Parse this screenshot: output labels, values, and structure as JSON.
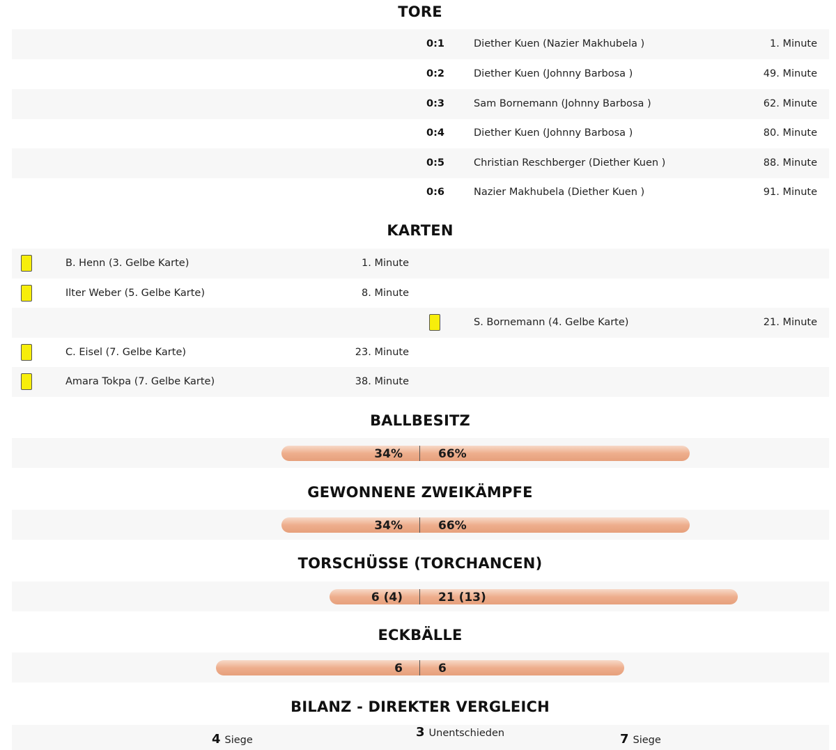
{
  "sections": {
    "tore": "TORE",
    "karten": "KARTEN",
    "ballbesitz": "BALLBESITZ",
    "zweikaempfe": "GEWONNENE ZWEIKÄMPFE",
    "torschuesse": "TORSCHÜSSE (TORCHANCEN)",
    "eckbaelle": "ECKBÄLLE",
    "bilanz": "BILANZ - DIREKTER VERGLEICH"
  },
  "goals": [
    {
      "score": "0:1",
      "scorer": "Diether Kuen (Nazier Makhubela )",
      "minute": "1. Minute"
    },
    {
      "score": "0:2",
      "scorer": "Diether Kuen (Johnny Barbosa )",
      "minute": "49. Minute"
    },
    {
      "score": "0:3",
      "scorer": "Sam Bornemann (Johnny Barbosa )",
      "minute": "62. Minute"
    },
    {
      "score": "0:4",
      "scorer": "Diether Kuen (Johnny Barbosa )",
      "minute": "80. Minute"
    },
    {
      "score": "0:5",
      "scorer": "Christian Reschberger (Diether Kuen )",
      "minute": "88. Minute"
    },
    {
      "score": "0:6",
      "scorer": "Nazier Makhubela (Diether Kuen )",
      "minute": "91. Minute"
    }
  ],
  "cards": [
    {
      "side": "home",
      "type": "yellow",
      "player": "B. Henn (3. Gelbe Karte)",
      "minute": "1. Minute"
    },
    {
      "side": "home",
      "type": "yellow",
      "player": "Ilter Weber (5. Gelbe Karte)",
      "minute": "8. Minute"
    },
    {
      "side": "away",
      "type": "yellow",
      "player": "S. Bornemann (4. Gelbe Karte)",
      "minute": "21. Minute"
    },
    {
      "side": "home",
      "type": "yellow",
      "player": "C. Eisel (7. Gelbe Karte)",
      "minute": "23. Minute"
    },
    {
      "side": "home",
      "type": "yellow",
      "player": "Amara Tokpa (7. Gelbe Karte)",
      "minute": "38. Minute"
    }
  ],
  "stats": {
    "ballbesitz": {
      "home": "34%",
      "away": "66%"
    },
    "zweikaempfe": {
      "home": "34%",
      "away": "66%"
    },
    "torschuesse": {
      "home": "6 (4)",
      "away": "21 (13)"
    },
    "eckbaelle": {
      "home": "6",
      "away": "6"
    }
  },
  "bilanz": {
    "home_wins": "4",
    "home_label": "Siege",
    "draws": "3",
    "draws_label": "Unentschieden",
    "away_wins": "7",
    "away_label": "Siege"
  },
  "colors": {
    "card_yellow": "#f7ee0b",
    "bar_light": "#f7d9c8",
    "bar_dark": "#e6a07c",
    "row_shade": "#f7f7f7"
  }
}
